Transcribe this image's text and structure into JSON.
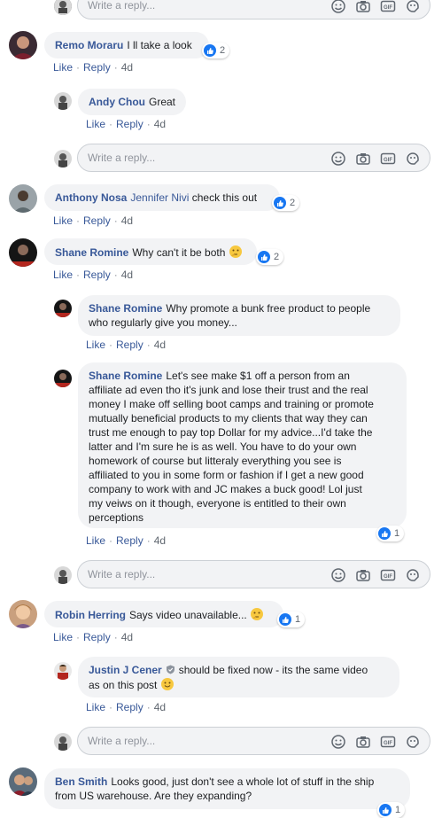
{
  "reply_placeholder": "Write a reply...",
  "gif_label": "GIF",
  "like_label": "Like",
  "reply_label": "Reply",
  "separator": "·",
  "comments": {
    "remo": {
      "author": "Remo Moraru",
      "text": "I ll take a look",
      "time": "4d",
      "reactions": "2"
    },
    "andy": {
      "author": "Andy Chou",
      "text": "Great",
      "time": "4d"
    },
    "anthony": {
      "author": "Anthony Nosa",
      "mention": "Jennifer Nivi",
      "text": "check this out",
      "time": "4d",
      "reactions": "2"
    },
    "shane1": {
      "author": "Shane Romine",
      "text": "Why can't it be both",
      "time": "4d",
      "reactions": "2"
    },
    "shane2": {
      "author": "Shane Romine",
      "line1": "Why promote a bunk free product to people",
      "line2": "who regularly give you money...",
      "time": "4d"
    },
    "shane3": {
      "author": "Shane Romine",
      "first_line": "Let's see make $1 off a person from an",
      "lines": [
        "affiliate ad even tho it's junk and lose their trust and the real",
        "money I make off selling boot camps and training or promote",
        "mutually beneficial products to my clients that way they can",
        "trust me enough to pay top Dollar for my advice...I'd take the",
        "latter and I'm sure he is as well. You have to do your own",
        "homework of course but litteraly everything you see is",
        "affiliated to you in some form or fashion if I get a new good",
        "company to work with and JC makes a buck good! Lol just",
        "my veiws on it though, everyone is entitled to their own",
        "perceptions"
      ],
      "time": "4d",
      "reactions": "1"
    },
    "robin": {
      "author": "Robin Herring",
      "text": "Says video unavailable...",
      "time": "4d",
      "reactions": "1"
    },
    "justin": {
      "author": "Justin J Cener",
      "line1": "should be fixed now - its the same video",
      "line2": "as on this post",
      "time": "4d"
    },
    "ben": {
      "author": "Ben Smith",
      "line1": "Looks good, just don't see a whole lot of stuff in the ship",
      "line2": "from US warehouse. Are they expanding?",
      "reactions": "1"
    }
  },
  "colors": {
    "link": "#385898",
    "bubble": "#f2f3f5",
    "like_blue": "#1877f2",
    "meta": "#606770"
  }
}
